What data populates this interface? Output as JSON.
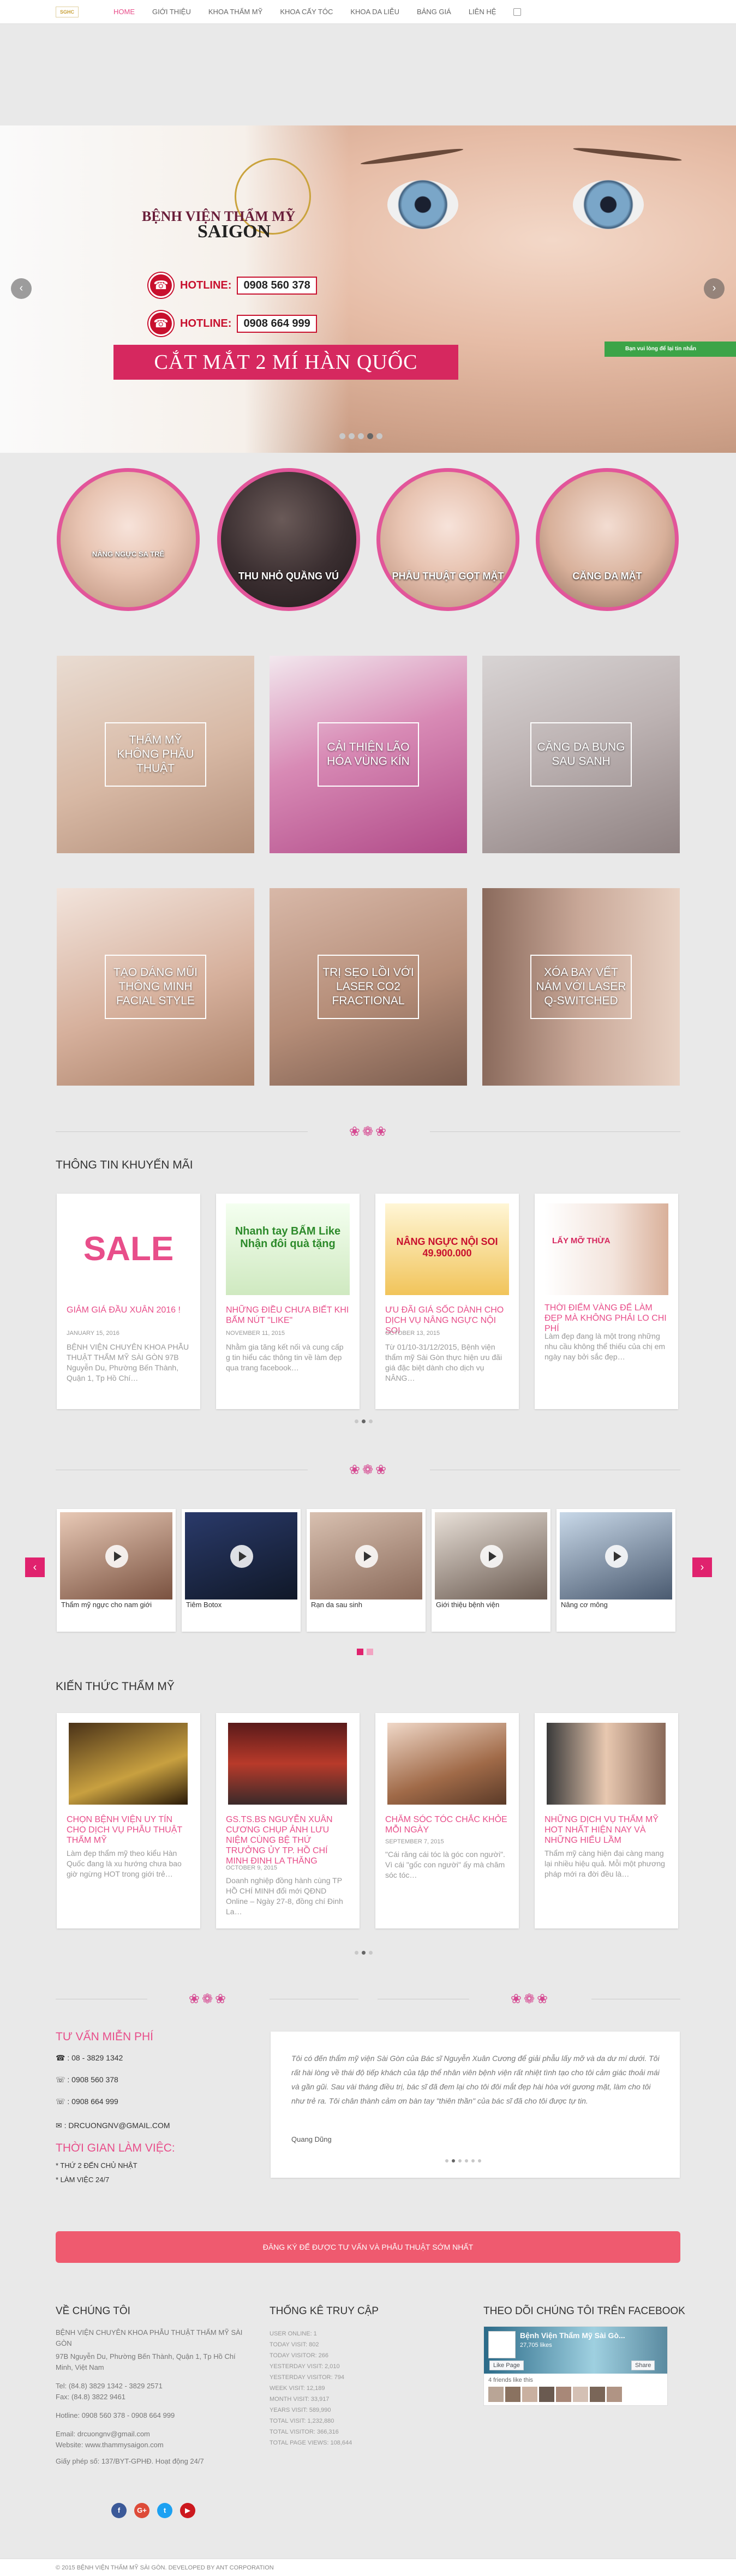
{
  "nav": {
    "logo_text": "SGHC",
    "items": [
      "Home",
      "Giới thiệu",
      "Khoa thẩm mỹ",
      "Khoa cấy tóc",
      "Khoa da liễu",
      "Bảng giá",
      "Liên hệ"
    ]
  },
  "slider": {
    "hospital_line1": "BỆNH VIỆN THẨM MỸ",
    "hospital_line2": "SAIGON",
    "hotline_label": "HOTLINE:",
    "hotline1": "0908 560 378",
    "hotline2": "0908 664 999",
    "banner": "CẮT MẮT 2 MÍ HÀN QUỐC",
    "prev": "‹",
    "next": "›",
    "badge": "Bạn vui lòng để lại tin nhắn"
  },
  "circles": [
    {
      "label": "NÂNG NGỰC SA TRỄ"
    },
    {
      "label": "THU NHỎ QUẦNG VÚ"
    },
    {
      "label": "PHẪU THUẬT GỌT MẶT"
    },
    {
      "label": "CĂNG DA MẶT"
    }
  ],
  "tiles": [
    {
      "label": "THẨM MỸ KHÔNG PHẪU THUẬT"
    },
    {
      "label": "CẢI THIỆN LÃO HÓA VÙNG KÍN"
    },
    {
      "label": "CĂNG DA BỤNG SAU SANH"
    },
    {
      "label": "TẠO DÁNG MŨI THÔNG MINH FACIAL STYLE"
    },
    {
      "label": "TRỊ SẸO LỒI VỚI LASER CO2 FRACTIONAL"
    },
    {
      "label": "XÓA BAY VẾT NÁM VỚI LASER Q-SWITCHED"
    }
  ],
  "promo": {
    "heading": "THÔNG TIN KHUYẾN MÃI",
    "cards": [
      {
        "img_text": "SALE",
        "title": "GIẢM GIÁ ĐẦU XUÂN 2016 !",
        "date": "JANUARY 15, 2016",
        "excerpt": "BỆNH VIỆN CHUYÊN KHOA PHẪU THUẬT THẨM MỸ SÀI GÒN 97B Nguyễn Du, Phường Bến Thành, Quận 1, Tp Hồ Chí…"
      },
      {
        "img_text": "Nhanh tay BẤM Like Nhận đôi quà tặng",
        "title": "NHỮNG ĐIỀU CHƯA BIẾT KHI BẤM NÚT \"LIKE\"",
        "date": "NOVEMBER 11, 2015",
        "excerpt": "Nhằm gia tăng kết nối và cung cấp g tin hiểu các thông tin về làm đẹp qua trang facebook…"
      },
      {
        "img_text": "NÂNG NGỰC NỘI SOI 49.900.000",
        "title": "ƯU ĐÃI GIÁ SỐC DÀNH CHO DỊCH VỤ NÂNG NGỰC NỘI SOI",
        "date": "OCTOBER 13, 2015",
        "excerpt": "Từ 01/10-31/12/2015, Bệnh viện thẩm mỹ Sài Gòn thực hiện ưu đãi giá đặc biệt dành cho dịch vụ NÂNG…"
      },
      {
        "img_text": "LẤY MỠ THỪA",
        "title": "THỜI ĐIỂM VÀNG ĐỂ LÀM ĐẸP MÀ KHÔNG PHẢI LO CHI PHÍ",
        "date": "",
        "excerpt": "Làm đẹp đang là một trong những nhu cầu không thể thiếu của chị em ngày nay bởi sắc đẹp…"
      }
    ]
  },
  "videos": {
    "prev": "‹",
    "next": "›",
    "items": [
      {
        "title": "Thẩm mỹ ngực cho nam giới"
      },
      {
        "title": "Tiêm Botox"
      },
      {
        "title": "Rạn da sau sinh"
      },
      {
        "title": "Giới thiệu bệnh viện"
      },
      {
        "title": "Nâng cơ mông"
      }
    ]
  },
  "knowledge": {
    "heading": "KIẾN THỨC THẨM MỸ",
    "cards": [
      {
        "title": "CHỌN BỆNH VIỆN UY TÍN CHO DỊCH VỤ PHẪU THUẬT THẨM MỸ",
        "date": "",
        "excerpt": "Làm đẹp thẩm mỹ theo kiểu Hàn Quốc đang là xu hướng chưa bao giờ ngừng HOT trong giới trẻ…"
      },
      {
        "title": "GS.TS.BS NGUYỄN XUÂN CƯƠNG CHỤP ẢNH LƯU NIỆM CÙNG BỆ THỨ TRƯỞNG ỦY TP. HỒ CHÍ MINH ĐINH LA THĂNG",
        "date": "OCTOBER 9, 2015",
        "excerpt": "Doanh nghiệp đồng hành cùng TP HỒ CHÍ MINH đổi mới QĐND Online – Ngày 27-8, đồng chí Đinh La…"
      },
      {
        "title": "CHĂM SÓC TÓC CHẮC KHỎE MỖI NGÀY",
        "date": "SEPTEMBER 7, 2015",
        "excerpt": "\"Cái răng cái tóc là góc con người\". Vì cái \"gốc con người\" ấy mà chăm sóc tóc…"
      },
      {
        "title": "NHỮNG DỊCH VỤ THẨM MỸ HOT NHẤT HIỆN NAY VÀ NHỮNG HIỂU LẦM",
        "date": "",
        "excerpt": "Thẩm mỹ càng hiện đại càng mang lại nhiều hiệu quả. Mỗi một phương pháp mới ra đời đều là…"
      }
    ]
  },
  "consult": {
    "heading": "TƯ VẤN MIỄN PHÍ",
    "phone1": ": 08 - 3829 1342",
    "phone2": ": 0908 560 378",
    "phone3": ": 0908 664 999",
    "email": ": DRCUONGNV@GMAIL.COM",
    "hours_heading": "THỜI GIAN LÀM VIỆC:",
    "hours1": "* THỨ 2 ĐẾN CHỦ NHẬT",
    "hours2": "* LÀM VIỆC 24/7"
  },
  "testimonial": {
    "text": "Tôi có đến thẩm mỹ viện Sài Gòn của Bác sĩ Nguyễn Xuân Cương để giải phẫu lấy mỡ và da dư mí dưới. Tôi rất hài lòng về thái độ tiếp khách của tập thể nhân viên bệnh viện rất nhiệt tình tạo cho tôi cảm giác thoải mái và gần gũi. Sau vài tháng điều trị, bác sĩ đã đem lại cho tôi đôi mắt đẹp hài hòa với gương mặt, làm cho tôi như trẻ ra. Tôi chân thành cảm ơn bàn tay \"thiên thần\" của bác sĩ đã cho tôi được tự tin.",
    "author": "Quang Dũng"
  },
  "cta": "ĐĂNG KÝ ĐỂ ĐƯỢC TƯ VẤN VÀ PHẪU THUẬT SỚM NHẤT",
  "about": {
    "heading": "VỀ CHÚNG TÔI",
    "name": "BỆNH VIỆN CHUYÊN KHOA PHẪU THUẬT THẨM MỸ SÀI GÒN",
    "address": "97B Nguyễn Du, Phường Bến Thành, Quận 1, Tp Hồ Chí Minh, Việt Nam",
    "tel": "Tel: (84.8) 3829 1342 - 3829 2571",
    "fax": "Fax: (84.8) 3822 9461",
    "hotline": "Hotline: 0908 560 378 - 0908 664 999",
    "email": "Email: drcuongnv@gmail.com",
    "website": "Website: www.thammysaigon.com",
    "license": "Giấy phép số: 137/BYT-GPHĐ. Hoạt động 24/7"
  },
  "stats": {
    "heading": "THỐNG KÊ TRUY CẬP",
    "rows": [
      "USER ONLINE: 1",
      "TODAY VISIT: 802",
      "TODAY VISITOR: 266",
      "YESTERDAY VISIT: 2,010",
      "YESTERDAY VISITOR: 794",
      "WEEK VISIT: 12,189",
      "MONTH VISIT: 33,917",
      "YEARS VISIT: 589,990",
      "TOTAL VISIT: 1,232,880",
      "TOTAL VISITOR: 366,316",
      "TOTAL PAGE VIEWS: 108,644"
    ]
  },
  "facebook": {
    "heading": "THEO DÕI CHÚNG TÔI TRÊN FACEBOOK",
    "page_name": "Bệnh Viện Thẩm Mỹ Sài Gò...",
    "likes": "27,705 likes",
    "like_btn": "Like Page",
    "share_btn": "Share",
    "friends": "4 friends like this"
  },
  "social": [
    "f",
    "G+",
    "t",
    "▶"
  ],
  "copyright": "© 2015 BỆNH VIỆN THẨM MỸ SÀI GÒN. DEVELOPED BY ANT CORPORATION"
}
